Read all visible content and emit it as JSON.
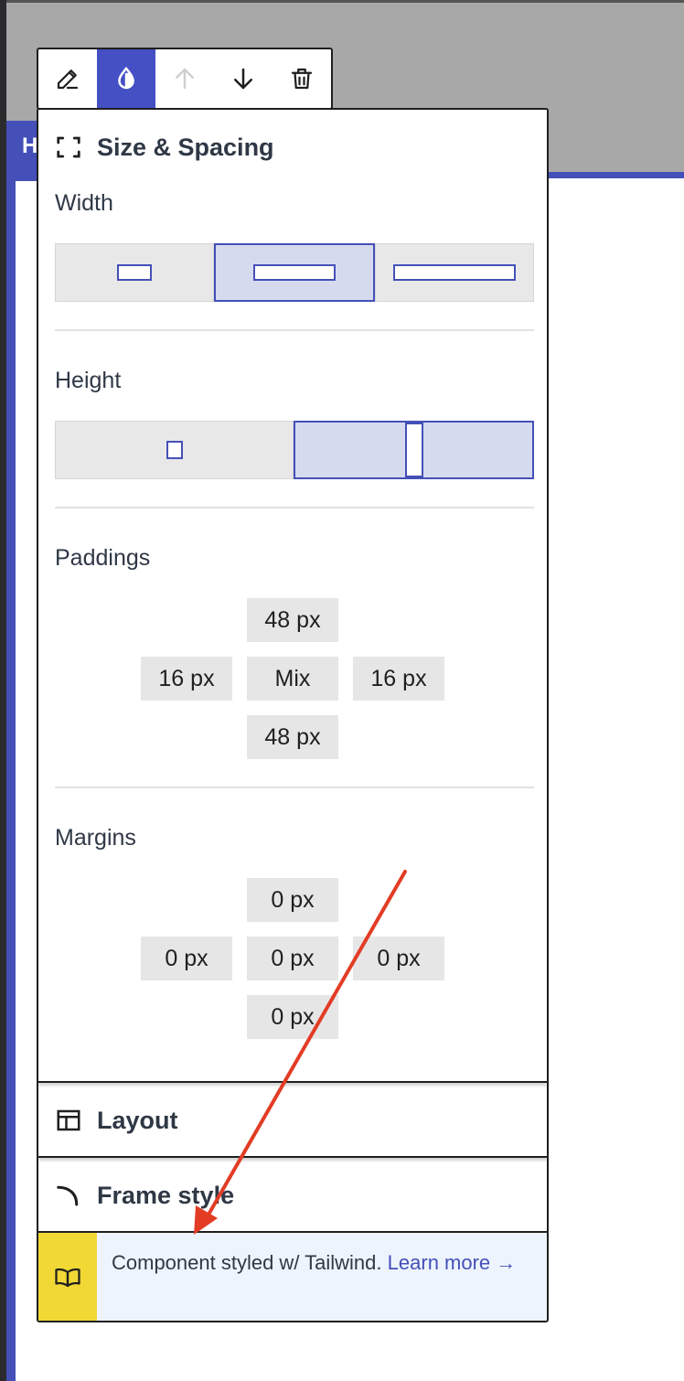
{
  "background": {
    "heading_fragment": "H",
    "accent_color": "#4450b8"
  },
  "toolbar": {
    "buttons": [
      {
        "name": "pencil-icon",
        "active": false
      },
      {
        "name": "color-drop-icon",
        "active": true
      },
      {
        "name": "arrow-up-icon",
        "disabled": true
      },
      {
        "name": "arrow-down-icon",
        "active": false
      },
      {
        "name": "trash-icon",
        "active": false
      }
    ]
  },
  "panel": {
    "size_spacing": {
      "title": "Size & Spacing",
      "icon": "resize-frame-icon",
      "width": {
        "label": "Width",
        "options": [
          "narrow",
          "medium",
          "wide"
        ],
        "selected": "medium"
      },
      "height": {
        "label": "Height",
        "options": [
          "short",
          "tall"
        ],
        "selected": "tall"
      },
      "paddings": {
        "label": "Paddings",
        "top": "48 px",
        "left": "16 px",
        "center": "Mix",
        "right": "16 px",
        "bottom": "48 px"
      },
      "margins": {
        "label": "Margins",
        "top": "0 px",
        "left": "0 px",
        "center": "0 px",
        "right": "0 px",
        "bottom": "0 px"
      }
    },
    "layout": {
      "title": "Layout",
      "icon": "layout-icon"
    },
    "frame_style": {
      "title": "Frame style",
      "icon": "corner-radius-icon"
    },
    "footer": {
      "icon": "book-icon",
      "text": "Component styled w/ Tailwind.",
      "link": "Learn more →"
    }
  },
  "annotation": {
    "arrow_color": "#e23c25"
  }
}
